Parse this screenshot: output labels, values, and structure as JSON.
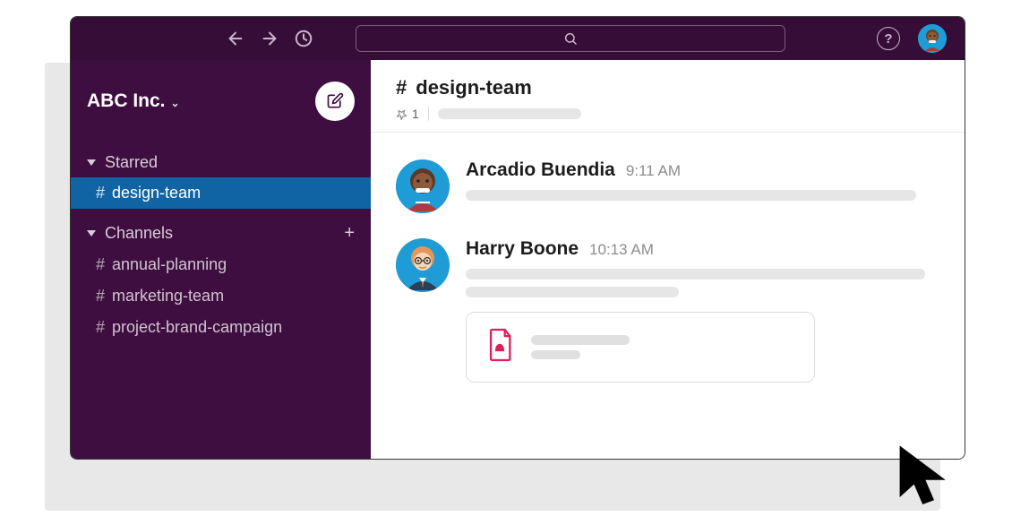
{
  "workspace": {
    "name": "ABC Inc."
  },
  "sidebar": {
    "starred": {
      "label": "Starred",
      "items": [
        {
          "name": "design-team",
          "active": true
        }
      ]
    },
    "channels": {
      "label": "Channels",
      "items": [
        {
          "name": "annual-planning"
        },
        {
          "name": "marketing-team"
        },
        {
          "name": "project-brand-campaign"
        }
      ]
    }
  },
  "channel": {
    "prefix": "#",
    "name": "design-team",
    "pinned": "1"
  },
  "messages": [
    {
      "author": "Arcadio Buendia",
      "time": "9:11 AM"
    },
    {
      "author": "Harry Boone",
      "time": "10:13 AM",
      "attachment": true
    }
  ]
}
